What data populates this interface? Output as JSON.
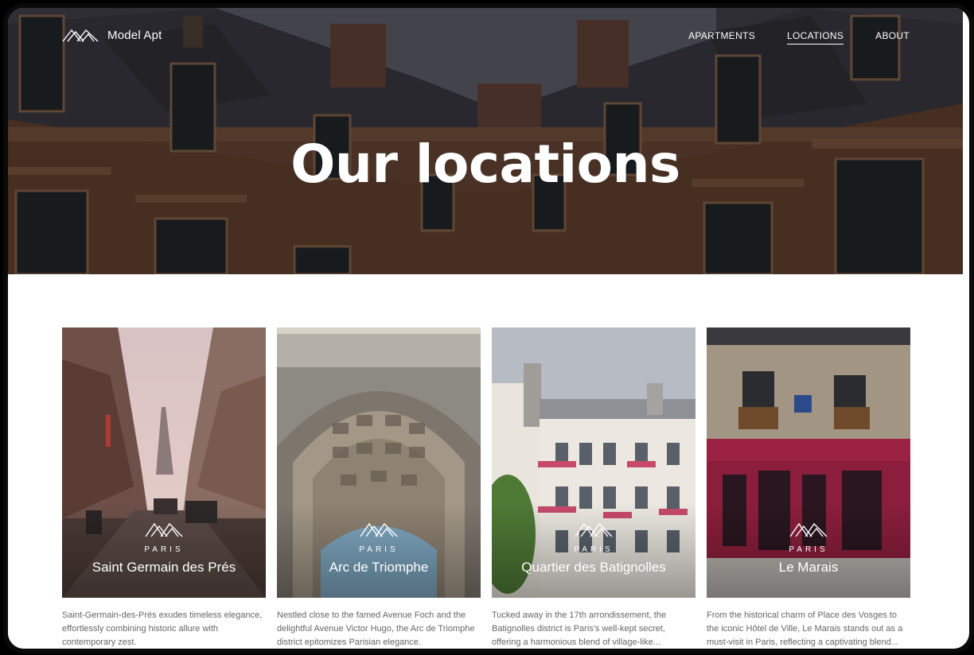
{
  "brand": {
    "name": "Model Apt"
  },
  "nav": {
    "items": [
      {
        "label": "APARTMENTS",
        "active": false
      },
      {
        "label": "LOCATIONS",
        "active": true
      },
      {
        "label": "ABOUT",
        "active": false
      }
    ]
  },
  "hero": {
    "title": "Our locations"
  },
  "locations": [
    {
      "city": "PARIS",
      "name": "Saint Germain des Prés",
      "description": "Saint-Germain-des-Prés exudes timeless elegance, effortlessly combining historic allure with contemporary zest."
    },
    {
      "city": "PARIS",
      "name": "Arc de Triomphe",
      "description": "Nestled close to the famed Avenue Foch and the delightful Avenue Victor Hugo, the Arc de Triomphe district epitomizes Parisian elegance."
    },
    {
      "city": "PARIS",
      "name": "Quartier des Batignolles",
      "description": "Tucked away in the 17th arrondissement, the Batignolles district is Paris's well-kept secret, offering a harmonious blend of village-like..."
    },
    {
      "city": "PARIS",
      "name": "Le Marais",
      "description": "From the historical charm of Place des Vosges to the iconic Hôtel de Ville, Le Marais stands out as a must-visit in Paris, reflecting a captivating blend..."
    }
  ]
}
